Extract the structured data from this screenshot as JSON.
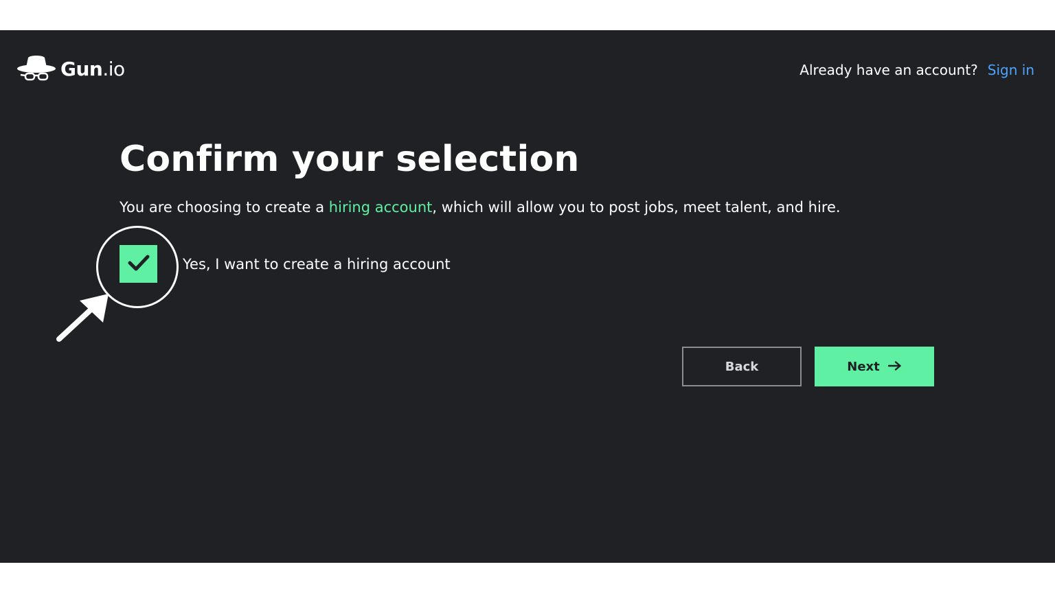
{
  "header": {
    "logo_text_bold": "Gun",
    "logo_text_thin": ".io",
    "logo_icon": "hat-glasses-icon",
    "account_prompt": "Already have an account?",
    "signin_label": "Sign in"
  },
  "main": {
    "title": "Confirm your selection",
    "desc_before": "You are choosing to create a ",
    "desc_accent": "hiring account",
    "desc_after": ", which will allow you to post jobs, meet talent, and hire.",
    "checkbox": {
      "checked": true,
      "label": "Yes, I want to create a hiring account"
    }
  },
  "actions": {
    "back_label": "Back",
    "next_label": "Next",
    "next_icon": "arrow-right-icon"
  },
  "colors": {
    "background": "#1f2125",
    "accent_green": "#5ff0a4",
    "link_blue": "#4ea3ff"
  }
}
